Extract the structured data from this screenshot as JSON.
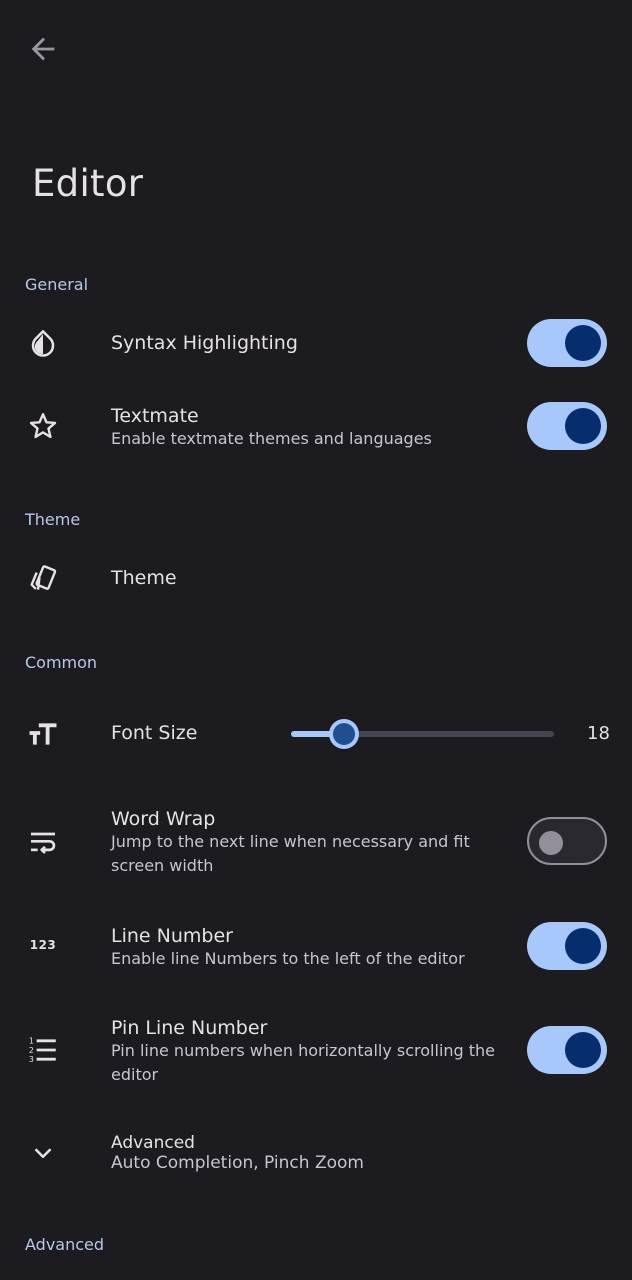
{
  "header": {
    "back_icon": "arrow-left-icon",
    "title": "Editor"
  },
  "sections": {
    "general": "General",
    "theme": "Theme",
    "common": "Common",
    "advanced": "Advanced"
  },
  "rows": {
    "syntax": {
      "icon": "contrast-drop-icon",
      "title": "Syntax Highlighting",
      "enabled": true
    },
    "textmate": {
      "icon": "star-outline-icon",
      "title": "Textmate",
      "subtitle": "Enable textmate themes and languages",
      "enabled": true
    },
    "theme": {
      "icon": "swatch-cards-icon",
      "title": "Theme"
    },
    "font_size": {
      "icon": "text-size-icon",
      "title": "Font Size",
      "value": "18",
      "slider_fraction": 0.2
    },
    "word_wrap": {
      "icon": "wrap-text-icon",
      "title": "Word Wrap",
      "subtitle": "Jump to the next line when necessary and fit screen width",
      "enabled": false
    },
    "line_number": {
      "icon": "numeric-123-icon",
      "title": "Line Number",
      "subtitle": "Enable line Numbers to the left of the editor",
      "enabled": true
    },
    "pin_line_number": {
      "icon": "numbered-list-icon",
      "title": "Pin Line Number",
      "subtitle": "Pin line numbers when horizontally scrolling the editor",
      "enabled": true
    },
    "advanced": {
      "icon": "chevron-down-icon",
      "title": "Advanced",
      "subtitle": "Auto Completion, Pinch Zoom"
    }
  },
  "colors": {
    "background": "#1c1b1f",
    "accent": "#a8c7fa",
    "knob_on": "#062e6f",
    "section_header": "#b9c8e8"
  }
}
